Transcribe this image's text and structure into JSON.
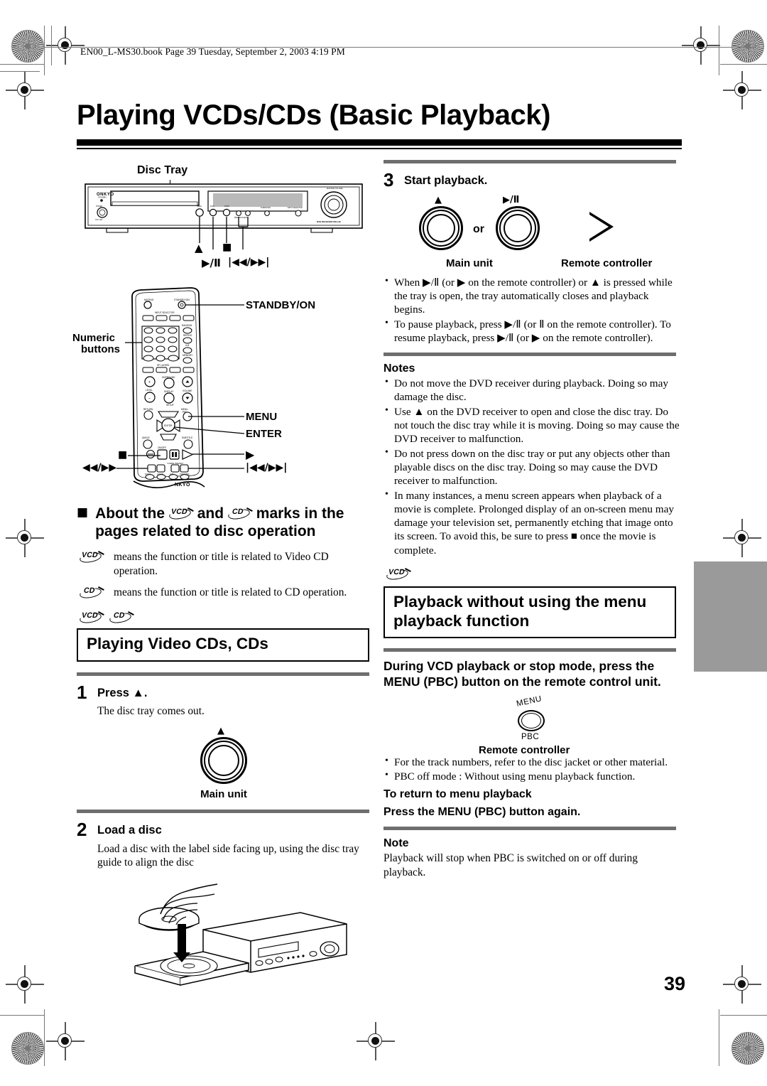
{
  "header": {
    "book_line": "EN00_L-MS30.book  Page 39  Tuesday, September 2, 2003  4:19 PM"
  },
  "page": {
    "title": "Playing VCDs/CDs (Basic Playback)",
    "number": "39"
  },
  "left_column": {
    "unit_diagram": {
      "disc_tray_label": "Disc Tray",
      "brand": "ONKYO",
      "model": "DVD RECEIVER  DR-L30",
      "callouts": {
        "eject": "▲",
        "play_pause": "▶/Ⅱ",
        "stop": "■",
        "skip": "|◀◀/▶▶|"
      }
    },
    "remote_diagram": {
      "labels": {
        "standby": "STANDBY/ON",
        "numeric": "Numeric\nbuttons",
        "numeric_line1": "Numeric",
        "numeric_line2": "buttons",
        "menu": "MENU",
        "enter": "ENTER",
        "play": "▶",
        "stop": "■",
        "scan": "◀◀/▶▶",
        "skip": "|◀◀/▶▶|"
      },
      "face_labels": {
        "muting": "MUTING",
        "standby": "STANDBY/ON",
        "input_selector": "INPUT SELECTOR",
        "random": "RANDOM",
        "repeat": "REPEAT",
        "ab": "A-B",
        "memory": "MEMORY",
        "sp_layers": "SP LAYERS",
        "level": "LEVEL",
        "surround": "SURROUND",
        "volume": "VOLUME",
        "display": "DISPLAY",
        "setup": "SETUP",
        "return": "RETURN",
        "menu_pbc": "MENU/PBC",
        "enter": "ENTER",
        "angle": "ANGLE",
        "subtitle": "SUBTITLE",
        "onoff": "ON/OFF",
        "brand": "ONKYO"
      }
    },
    "about_section": {
      "bullet": "■",
      "heading_line1": "About the",
      "heading_mid": "and",
      "heading_line1_end": "marks in the",
      "heading_line2": "pages related to disc operation",
      "vcd_text": "means the function or title is related to Video CD operation.",
      "cd_text": "means the function or title is related to CD operation."
    },
    "playing_section": {
      "marks": [
        "VCD",
        "CD"
      ],
      "box_title": "Playing Video CDs, CDs",
      "steps": [
        {
          "number": "1",
          "title": "Press ▲.",
          "body": "The disc tray comes out.",
          "caption": "Main unit"
        },
        {
          "number": "2",
          "title": "Load a disc",
          "body": "Load a disc with the label side facing up, using the disc tray guide to align the disc"
        }
      ]
    }
  },
  "right_column": {
    "step3": {
      "number": "3",
      "title": "Start playback.",
      "eject_symbol": "▲",
      "play_pause_symbol": "▶/Ⅱ",
      "or_label": "or",
      "caption_main": "Main unit",
      "caption_remote": "Remote controller",
      "bullets": [
        "When ▶/Ⅱ (or ▶ on the remote controller) or ▲ is pressed while the tray is open, the tray automatically closes and playback begins.",
        "To pause playback, press ▶/Ⅱ (or Ⅱ on the remote controller). To resume playback, press ▶/Ⅱ (or ▶ on the remote controller)."
      ]
    },
    "notes": {
      "heading": "Notes",
      "items": [
        "Do not move the DVD receiver during playback. Doing so may damage the disc.",
        "Use ▲ on the DVD receiver to open and close the disc tray. Do not touch the disc tray while it is moving. Doing so may cause the DVD receiver to malfunction.",
        "Do not press down on the disc tray or put any objects other than playable discs on the disc tray. Doing so may cause the DVD receiver to malfunction.",
        "In many instances, a menu screen appears when playback of a movie is complete. Prolonged display of an on-screen menu may damage your television set, permanently etching that image onto its screen. To avoid this, be sure to press ■ once the movie is complete."
      ]
    },
    "pbc_section": {
      "mark": "VCD",
      "box_title_line1": "Playback without using the menu",
      "box_title_line2": "playback function",
      "instruction_line1": "During VCD playback or stop mode, press the",
      "instruction_line2": "MENU (PBC) button on the remote control unit.",
      "button_label_top": "MENU",
      "button_label_bottom": "PBC",
      "caption_remote": "Remote controller",
      "bullets": [
        "For the track numbers, refer to the disc jacket or other material.",
        "PBC off mode : Without using menu playback function."
      ],
      "return_heading": "To return to menu playback",
      "return_text": "Press the MENU (PBC) button again.",
      "note_heading": "Note",
      "note_text": "Playback will stop when PBC is switched on or off during playback."
    }
  },
  "colors": {
    "rule_gray": "#6e6e6e",
    "tab_gray": "#9a9a9a",
    "ink": "#000000"
  }
}
